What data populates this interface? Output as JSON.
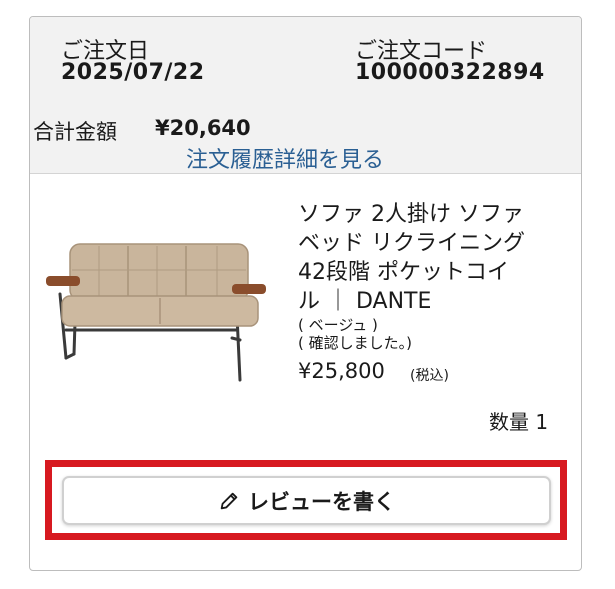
{
  "order": {
    "date_label": "ご注文日",
    "date_value": "2025/07/22",
    "code_label": "ご注文コード",
    "code_value": "100000322894",
    "total_label": "合計金額",
    "total_value": "¥20,640",
    "history_link": "注文履歴詳細を見る"
  },
  "product": {
    "name_line1": "ソファ 2人掛け ソファ",
    "name_line2": "ベッド リクライニング",
    "name_line3": "42段階 ポケットコイ",
    "name_line4": "ル ｜ DANTE",
    "color_option": "( ベージュ )",
    "confirm_option": "( 確認しました。)",
    "price": "¥25,800",
    "tax_note": "(税込)",
    "quantity": "数量 1",
    "image_icon": "sofa-image"
  },
  "review": {
    "button_label": "レビューを書く",
    "icon": "pencil-icon",
    "highlight_color": "#d71920"
  },
  "colors": {
    "link": "#2a5f93",
    "header_bg": "#f2f2f2"
  }
}
